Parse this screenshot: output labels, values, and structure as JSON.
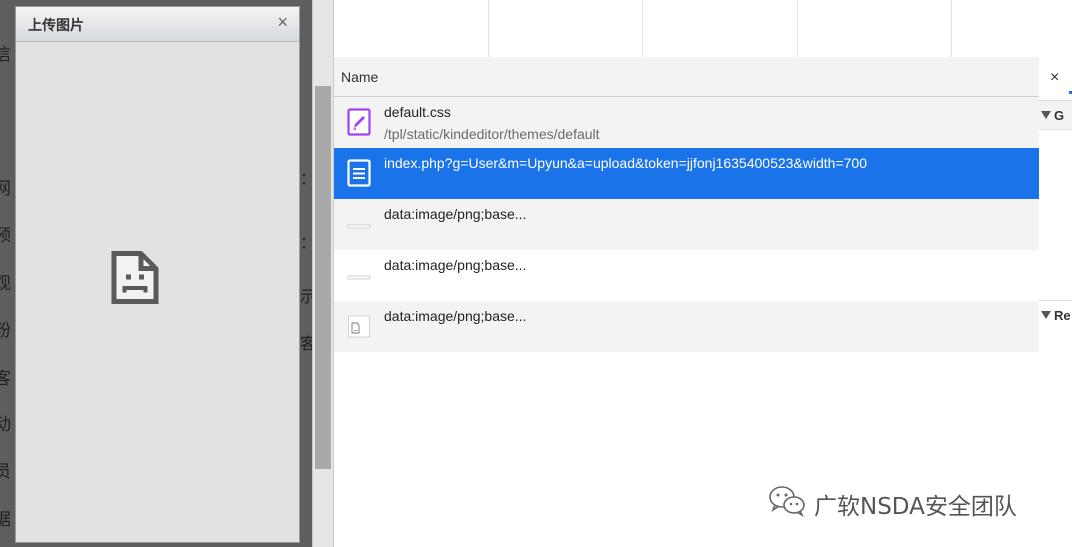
{
  "background_site": {
    "left_chars": [
      "信",
      "网",
      "预",
      "观",
      "粉",
      "客",
      "动",
      "员",
      "据"
    ],
    "right_chars": [
      "：",
      "：",
      "示",
      "客"
    ]
  },
  "dialog": {
    "title": "上传图片",
    "close_glyph": "×"
  },
  "network": {
    "column_header": "Name",
    "rows": [
      {
        "name": "default.css",
        "path": "/tpl/static/kindeditor/themes/default",
        "icon": "stylesheet-icon"
      },
      {
        "name": "index.php?g=User&m=Upyun&a=upload&token=jjfonj1635400523&width=700",
        "path": "",
        "icon": "document-icon",
        "selected": true
      },
      {
        "name": "data:image/png;base...",
        "path": "",
        "icon": "image-thumb-icon"
      },
      {
        "name": "data:image/png;base...",
        "path": "",
        "icon": "image-thumb-icon"
      },
      {
        "name": "data:image/png;base...",
        "path": "",
        "icon": "image-thumb-icon"
      }
    ]
  },
  "side_pane": {
    "close_glyph": "×",
    "section1_label": "G",
    "section2_label": "Re"
  },
  "watermark": {
    "text": "广软NSDA安全团队"
  },
  "colors": {
    "selected_row": "#1a73e8",
    "css_icon": "#a142f4",
    "dialog_bg": "#e2e2e2"
  }
}
